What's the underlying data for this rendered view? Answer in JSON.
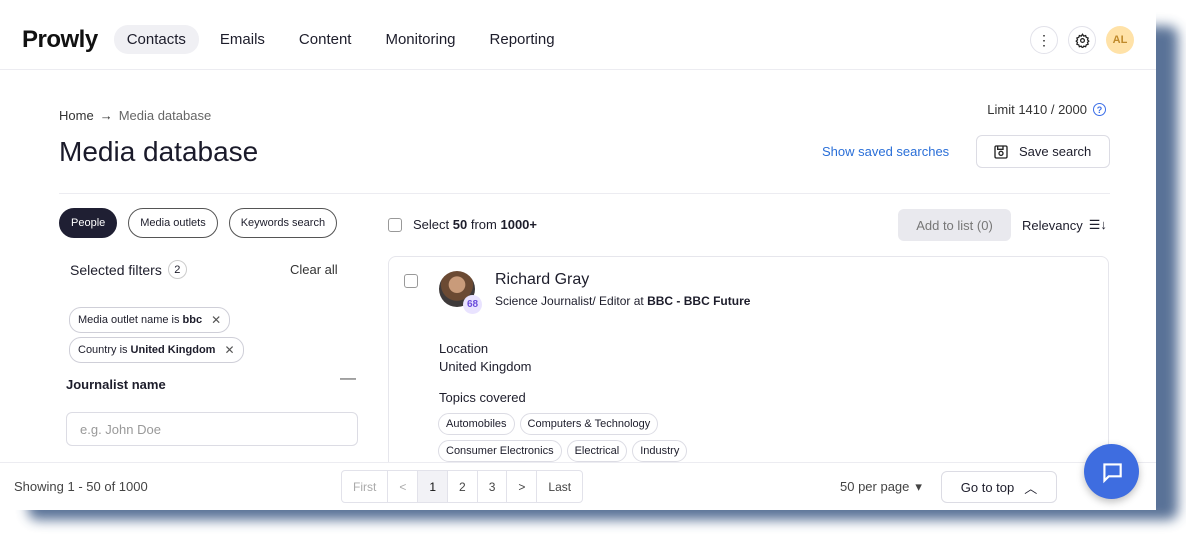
{
  "app": {
    "logo": "Prowly"
  },
  "nav": {
    "items": [
      "Contacts",
      "Emails",
      "Content",
      "Monitoring",
      "Reporting"
    ],
    "active": "Contacts"
  },
  "user": {
    "initials": "AL"
  },
  "breadcrumb": {
    "home": "Home",
    "current": "Media database"
  },
  "page": {
    "title": "Media database"
  },
  "limit": {
    "text": "Limit 1410 / 2000"
  },
  "saved": {
    "link": "Show saved searches",
    "save_button": "Save search"
  },
  "filter_tabs": [
    "People",
    "Media outlets",
    "Keywords search"
  ],
  "filters": {
    "title": "Selected filters",
    "count": "2",
    "clear_label": "Clear all",
    "chips": [
      {
        "prefix": "Media outlet name is",
        "value": "bbc"
      },
      {
        "prefix": "Country is",
        "value": "United Kingdom"
      }
    ],
    "journalist_label": "Journalist name",
    "journalist_placeholder": "e.g. John Doe"
  },
  "results": {
    "select_prefix": "Select",
    "select_count": "50",
    "select_mid": "from",
    "select_total": "1000+",
    "add_to_list": "Add to list (0)",
    "sort": "Relevancy"
  },
  "card": {
    "name": "Richard Gray",
    "score": "68",
    "role_prefix": "Science Journalist/ Editor at",
    "outlet": "BBC - BBC Future",
    "location_label": "Location",
    "location_value": "United Kingdom",
    "topics_label": "Topics covered",
    "topics_row1": [
      "Automobiles",
      "Computers & Technology"
    ],
    "topics_row2": [
      "Consumer Electronics",
      "Electrical",
      "Industry"
    ]
  },
  "footer": {
    "showing": "Showing 1 - 50 of 1000",
    "pager": [
      "First",
      "<",
      "1",
      "2",
      "3",
      ">",
      "Last"
    ],
    "current_page": "1",
    "per_page": "50 per page",
    "go_top": "Go to top"
  },
  "colors": {
    "accent": "#3e6de0",
    "dark_pill": "#1f1f33",
    "avatar_bg": "#ffe2a8"
  }
}
